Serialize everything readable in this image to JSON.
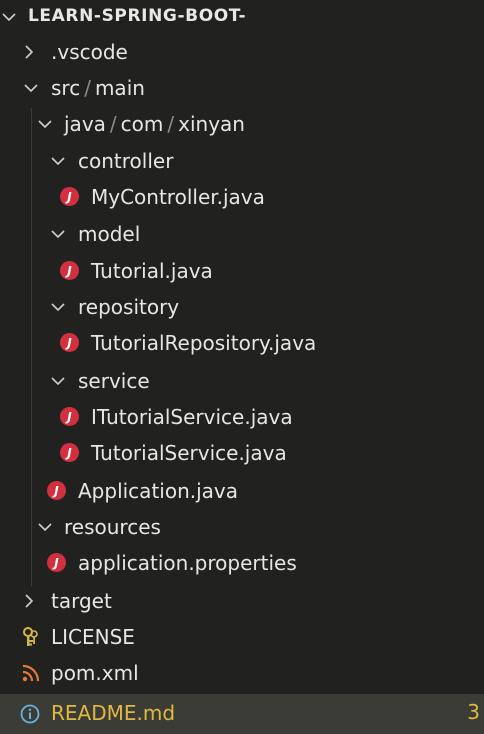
{
  "explorer": {
    "title": "LEARN-SPRING-BOOT-",
    "items": [
      {
        "label": ".vscode",
        "kind": "folder",
        "expanded": false
      },
      {
        "label_parts": [
          "src",
          "main"
        ],
        "kind": "folder",
        "expanded": true
      },
      {
        "label_parts": [
          "java",
          "com",
          "xinyan"
        ],
        "kind": "folder",
        "expanded": true
      },
      {
        "label": "controller",
        "kind": "folder",
        "expanded": true
      },
      {
        "label": "MyController.java",
        "kind": "java-file"
      },
      {
        "label": "model",
        "kind": "folder",
        "expanded": true
      },
      {
        "label": "Tutorial.java",
        "kind": "java-file"
      },
      {
        "label": "repository",
        "kind": "folder",
        "expanded": true
      },
      {
        "label": "TutorialRepository.java",
        "kind": "java-file"
      },
      {
        "label": "service",
        "kind": "folder",
        "expanded": true
      },
      {
        "label": "ITutorialService.java",
        "kind": "java-file"
      },
      {
        "label": "TutorialService.java",
        "kind": "java-file"
      },
      {
        "label": "Application.java",
        "kind": "java-file"
      },
      {
        "label": "resources",
        "kind": "folder",
        "expanded": true
      },
      {
        "label": "application.properties",
        "kind": "java-file"
      },
      {
        "label": "target",
        "kind": "folder",
        "expanded": false
      },
      {
        "label": "LICENSE",
        "kind": "license-file"
      },
      {
        "label": "pom.xml",
        "kind": "xml-file"
      },
      {
        "label": "README.md",
        "kind": "info-file",
        "badge": "3",
        "selected": true
      }
    ],
    "path_separator": "/",
    "java_icon_glyph": "J",
    "colors": {
      "background": "#21221f",
      "java_icon": "#d2303f",
      "selected_row": "#3b3c36",
      "readme_text": "#e1b941",
      "license_icon": "#d6b84a",
      "xml_icon": "#e37933",
      "info_icon": "#6ab0e0"
    },
    "icons": {
      "expanded": "chevron-down-icon",
      "collapsed": "chevron-right-icon",
      "java": "java-file-icon",
      "license": "license-key-icon",
      "xml": "rss-xml-icon",
      "info": "info-icon"
    }
  }
}
